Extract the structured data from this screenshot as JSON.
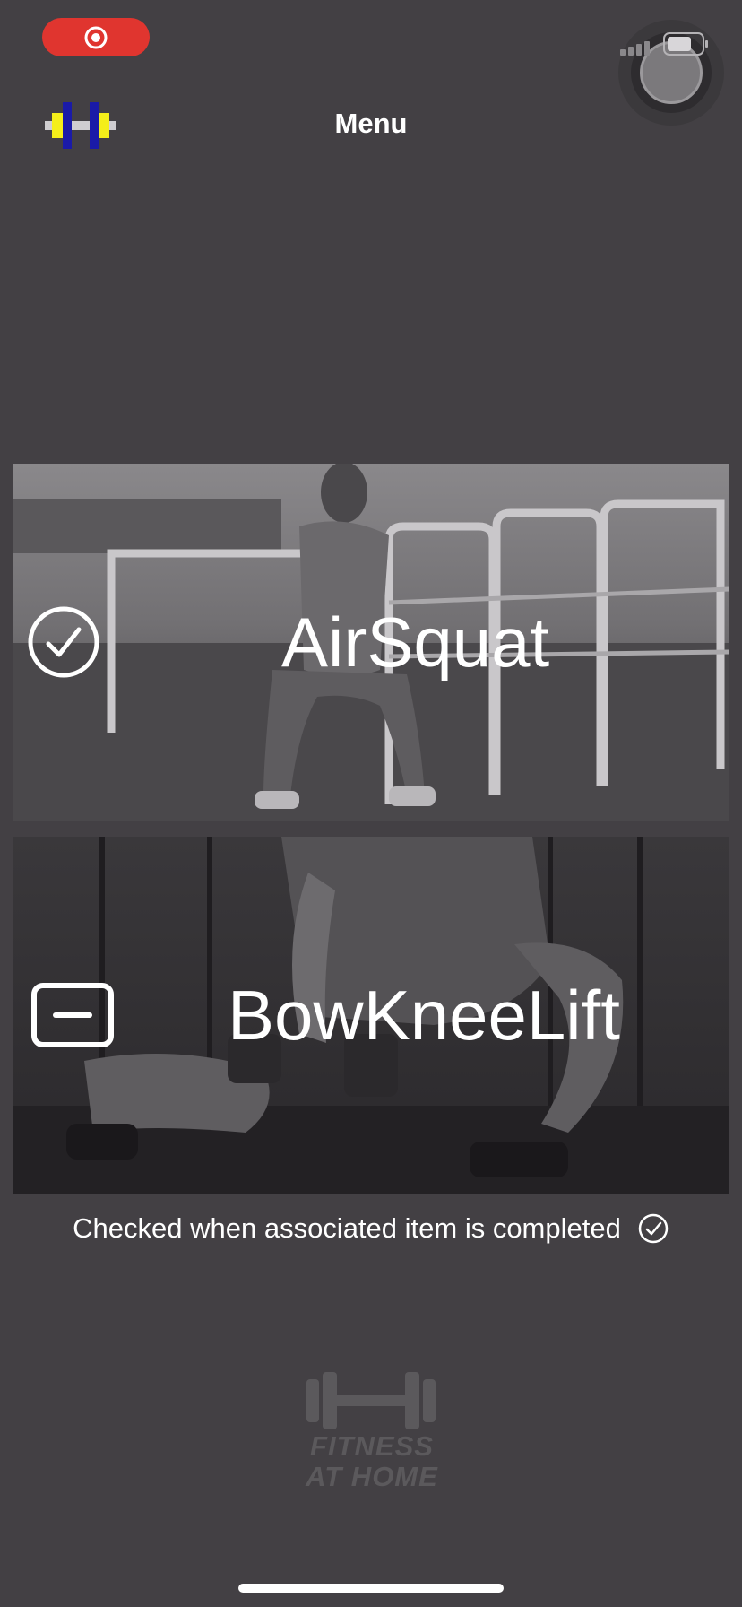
{
  "status_bar": {
    "recording_icon": "record-icon",
    "battery_icon": "battery-icon",
    "signal_icon": "signal-icon",
    "recording_color": "#e0352f"
  },
  "header": {
    "title": "Menu",
    "logo_icon": "barbell-logo-icon"
  },
  "cards": [
    {
      "label": "AirSquat",
      "status_icon": "checkmark-circle-icon",
      "completed": true
    },
    {
      "label": "BowKneeLift",
      "status_icon": "empty-box-icon",
      "completed": false
    }
  ],
  "footnote": {
    "text": "Checked when associated item is completed",
    "icon": "checkmark-circle-icon"
  },
  "brand": {
    "line1": "FITNESS",
    "line2": "AT HOME",
    "icon": "dumbbell-icon"
  },
  "colors": {
    "background": "#434044",
    "text": "#ffffff",
    "logo_blue": "#1a1aa8",
    "logo_yellow": "#f4ee1a"
  }
}
